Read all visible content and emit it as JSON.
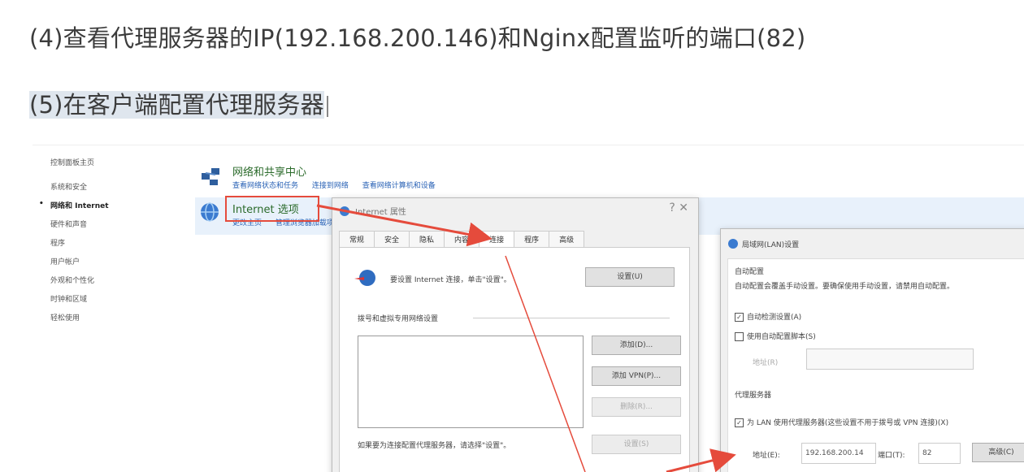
{
  "doc": {
    "step4": "(4)查看代理服务器的IP(192.168.200.146)和Nginx配置监听的端口(82)",
    "step5": "(5)在客户端配置代理服务器"
  },
  "control_panel": {
    "nav": [
      "控制面板主页",
      "系统和安全",
      "网络和 Internet",
      "硬件和声音",
      "程序",
      "用户帐户",
      "外观和个性化",
      "时钟和区域",
      "轻松使用"
    ],
    "network_center": "网络和共享中心",
    "network_links": [
      "查看网络状态和任务",
      "连接到网络",
      "查看网络计算机和设备"
    ],
    "internet_options": "Internet 选项",
    "internet_links": [
      "更改主页",
      "管理浏览器加载项"
    ]
  },
  "internet_dialog": {
    "title": "Internet 属性",
    "controls": "?   ✕",
    "tabs": [
      "常规",
      "安全",
      "隐私",
      "内容",
      "连接",
      "程序",
      "高级"
    ],
    "setup_text": "要设置 Internet 连接，单击\"设置\"。",
    "setup_btn": "设置(U)",
    "vpn_header": "拨号和虚拟专用网络设置",
    "add_btn": "添加(D)...",
    "add_vpn_btn": "添加 VPN(P)...",
    "remove_btn": "删除(R)...",
    "proxy_hint": "如果要为连接配置代理服务器，请选择\"设置\"。",
    "settings_btn": "设置(S)"
  },
  "lan_dialog": {
    "title": "局域网(LAN)设置",
    "auto_header": "自动配置",
    "auto_desc": "自动配置会覆盖手动设置。要确保使用手动设置，请禁用自动配置。",
    "auto_detect": "自动检测设置(A)",
    "auto_script": "使用自动配置脚本(S)",
    "address_label": "地址(R)",
    "proxy_header": "代理服务器",
    "proxy_check": "为 LAN 使用代理服务器(这些设置不用于拨号或 VPN 连接)(X)",
    "address2_label": "地址(E):",
    "address_value": "192.168.200.14",
    "port_label": "端口(T):",
    "port_value": "82",
    "advanced_btn": "高级(C)"
  },
  "colors": {
    "accent_red": "#e54b3c",
    "link_blue": "#2b63b6",
    "cat_green": "#2a6a2a"
  }
}
